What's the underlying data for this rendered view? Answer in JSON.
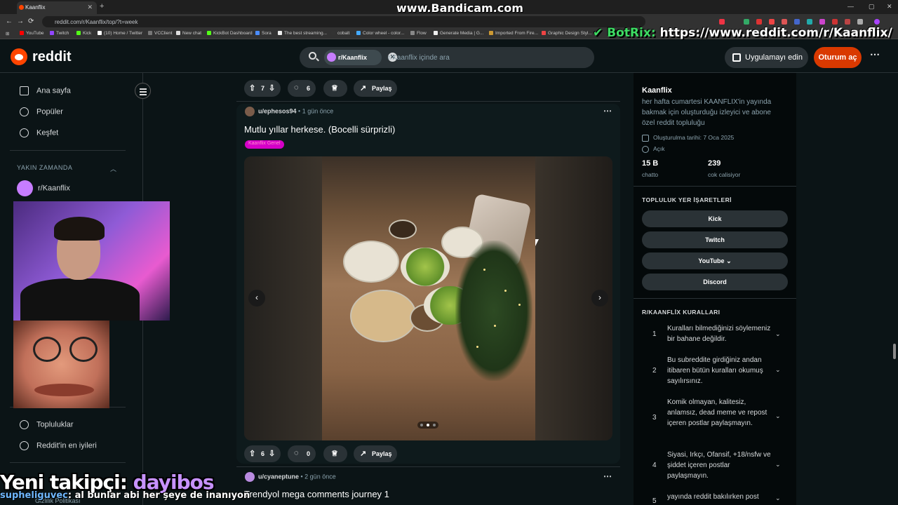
{
  "browser": {
    "tab_title": "Kaanflix",
    "url": "reddit.com/r/Kaanflix/top/?t=week",
    "watermark": "www.Bandicam.com",
    "bookmarks": [
      "YouTube",
      "Twitch",
      "Kick",
      "(10) Home / Twitter",
      "VCClient",
      "New chat",
      "KickBot Dashboard",
      "Sora",
      "The best streaming...",
      "cobalt",
      "Color wheel - color...",
      "Flow",
      "Generate Media | G...",
      "Imported From Fire...",
      "Graphic Design Styl..."
    ]
  },
  "overlay": {
    "botrix_prefix": "BotRix:",
    "botrix_url": "https://www.reddit.com/r/Kaanflix/",
    "follower_label": "Yeni takipçi:",
    "follower_name": "dayibos",
    "chat_user": "supheliguvec",
    "chat_message": ": al bunlar abi her şeye de inanıyon",
    "faded_text": "Gizlilik Politikası"
  },
  "header": {
    "logo": "reddit",
    "search_chip": "r/Kaanflix",
    "search_placeholder": "r/Kaanflix içinde ara",
    "get_app": "Uygulamayı edin",
    "login": "Oturum aç"
  },
  "sidebar": {
    "items": [
      {
        "label": "Ana sayfa",
        "icon": "home-icon"
      },
      {
        "label": "Popüler",
        "icon": "popular-icon"
      },
      {
        "label": "Keşfet",
        "icon": "explore-icon"
      }
    ],
    "recent_header": "YAKIN ZAMANDA",
    "recent_item": "r/Kaanflix",
    "bottom_items": [
      {
        "label": "Topluluklar",
        "icon": "communities-icon"
      },
      {
        "label": "Reddit'in en iyileri",
        "icon": "best-icon"
      }
    ]
  },
  "feed": {
    "prev_post": {
      "votes": "7",
      "comments": "6",
      "share": "Paylaş"
    },
    "post": {
      "author": "u/ephesos94",
      "time": "1 gün önce",
      "title": "Mutlu yıllar herkese. (Bocelli sürprizli)",
      "flair": "Kaanflix Genel",
      "votes": "6",
      "comments": "0",
      "share": "Paylaş",
      "carousel_dots": 3,
      "carousel_active": 2
    },
    "next_post": {
      "author": "u/cyaneptune",
      "time": "2 gün önce",
      "title": "Trendyol mega comments journey 1"
    }
  },
  "community": {
    "name": "Kaanflix",
    "description": "her hafta cumartesi KAANFLIX'in yayında bakmak için oluşturduğu izleyici ve abone özel reddit topluluğu",
    "created": "Oluşturulma tarihi: 7 Oca 2025",
    "visibility": "Açık",
    "members_value": "15 B",
    "members_label": "chatto",
    "online_value": "239",
    "online_label": "cok calisiyor",
    "bookmarks_header": "TOPLULUK YER İŞARETLERİ",
    "bookmarks": [
      "Kick",
      "Twitch",
      "YouTube",
      "Discord"
    ],
    "rules_header": "R/KAANFLİX KURALLARI",
    "rules": [
      {
        "n": "1",
        "text": "Kuralları bilmediğinizi söylemeniz bir bahane değildir."
      },
      {
        "n": "2",
        "text": "Bu subreddite girdiğiniz andan itibaren bütün kuralları okumuş sayılırsınız."
      },
      {
        "n": "3",
        "text": "Komik olmayan, kalitesiz, anlamsız, dead meme ve repost içeren postlar paylaşmayın."
      },
      {
        "n": "4",
        "text": "Siyasi, Irkçı, Ofansif, +18/nsfw ve şiddet içeren postlar paylaşmayın."
      },
      {
        "n": "5",
        "text": "yayında reddit bakılırken post"
      }
    ]
  },
  "colors": {
    "accent": "#ff4500",
    "login": "#d93900",
    "bg": "#0b1416",
    "flair": "#d500c7"
  }
}
